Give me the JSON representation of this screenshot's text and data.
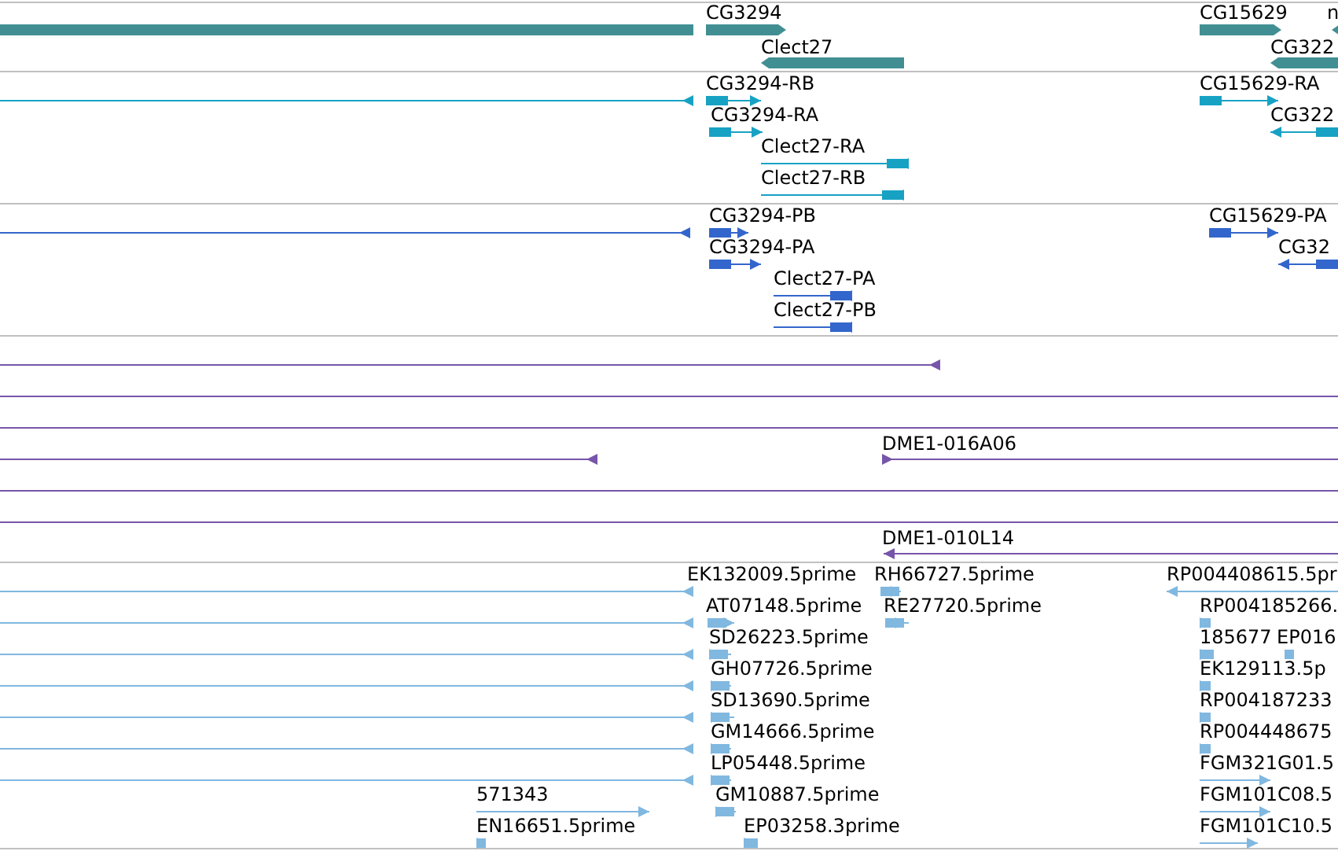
{
  "tracks": [
    {
      "kind": "gene",
      "color": "#418f93",
      "features": [
        {
          "kind": "span"
        },
        {
          "kind": "feature",
          "label": "CG3294",
          "reverse": false
        },
        {
          "kind": "feature",
          "label": "Clect27",
          "reverse": true
        },
        {
          "kind": "feature",
          "label": "CG15629",
          "reverse": false
        },
        {
          "kind": "feature",
          "label": "n",
          "reverse": true
        },
        {
          "kind": "feature",
          "label": "CG322",
          "reverse": true
        }
      ]
    },
    {
      "kind": "transcript",
      "color": "#17a2c4",
      "features": [
        {
          "kind": "feature",
          "reverse": true
        },
        {
          "kind": "feature",
          "label": "CG3294-RB",
          "reverse": false
        },
        {
          "kind": "feature",
          "label": "CG3294-RA",
          "reverse": false
        },
        {
          "kind": "feature",
          "label": "Clect27-RA",
          "reverse": true
        },
        {
          "kind": "feature",
          "label": "Clect27-RB",
          "reverse": true
        },
        {
          "kind": "feature",
          "label": "CG15629-RA",
          "reverse": false
        },
        {
          "kind": "feature",
          "label": "CG322",
          "reverse": true
        }
      ]
    },
    {
      "kind": "transcript",
      "color": "#3366cc",
      "features": [
        {
          "kind": "feature",
          "reverse": true
        },
        {
          "kind": "feature",
          "label": "CG3294-PB",
          "reverse": false
        },
        {
          "kind": "feature",
          "label": "CG3294-PA",
          "reverse": false
        },
        {
          "kind": "feature",
          "label": "Clect27-PA",
          "reverse": true
        },
        {
          "kind": "feature",
          "label": "Clect27-PB",
          "reverse": true
        },
        {
          "kind": "feature",
          "label": "CG15629-PA",
          "reverse": false
        },
        {
          "kind": "feature",
          "label": "CG32",
          "reverse": true
        }
      ]
    },
    {
      "kind": "clone",
      "color": "#7755aa",
      "features": [
        {
          "kind": "feature",
          "reverse": true
        },
        {
          "kind": "span"
        },
        {
          "kind": "span"
        },
        {
          "kind": "feature",
          "reverse": true
        },
        {
          "kind": "feature",
          "label": "DME1-016A06",
          "reverse": false
        },
        {
          "kind": "span"
        },
        {
          "kind": "span"
        },
        {
          "kind": "feature",
          "label": "DME1-010L14",
          "reverse": true
        }
      ]
    },
    {
      "kind": "est",
      "color": "#80b8e0",
      "features": [
        {
          "kind": "feature",
          "label": "EK132009.5prime",
          "reverse": true
        },
        {
          "kind": "feature",
          "label": "RH66727.5prime",
          "reverse": true
        },
        {
          "kind": "feature",
          "label": "RP004408615.5pr",
          "reverse": true
        },
        {
          "kind": "feature",
          "reverse": true
        },
        {
          "kind": "feature",
          "label": "AT07148.5prime",
          "reverse": false
        },
        {
          "kind": "feature",
          "label": "RE27720.5prime",
          "reverse": true
        },
        {
          "kind": "feature",
          "label": "RP004185266.",
          "reverse": false
        },
        {
          "kind": "feature",
          "reverse": true
        },
        {
          "kind": "feature",
          "label": "SD26223.5prime",
          "reverse": false
        },
        {
          "kind": "feature",
          "label": "185677",
          "reverse": false
        },
        {
          "kind": "feature",
          "label": "EP016",
          "reverse": true
        },
        {
          "kind": "feature",
          "reverse": true
        },
        {
          "kind": "feature",
          "label": "GH07726.5prime",
          "reverse": false
        },
        {
          "kind": "feature",
          "label": "EK129113.5p",
          "reverse": false
        },
        {
          "kind": "feature",
          "reverse": true
        },
        {
          "kind": "feature",
          "label": "SD13690.5prime",
          "reverse": false
        },
        {
          "kind": "feature",
          "label": "RP004187233",
          "reverse": false
        },
        {
          "kind": "feature",
          "reverse": true
        },
        {
          "kind": "feature",
          "label": "GM14666.5prime",
          "reverse": false
        },
        {
          "kind": "feature",
          "label": "RP004448675",
          "reverse": false
        },
        {
          "kind": "feature",
          "reverse": true
        },
        {
          "kind": "feature",
          "label": "LP05448.5prime",
          "reverse": false
        },
        {
          "kind": "feature",
          "label": "FGM321G01.5",
          "reverse": false
        },
        {
          "kind": "feature",
          "label": "571343",
          "reverse": false
        },
        {
          "kind": "feature",
          "label": "GM10887.5prime",
          "reverse": false
        },
        {
          "kind": "feature",
          "label": "FGM101C08.5",
          "reverse": false
        },
        {
          "kind": "feature",
          "label": "EN16651.5prime",
          "reverse": false
        },
        {
          "kind": "feature",
          "label": "EP03258.3prime",
          "reverse": false
        },
        {
          "kind": "feature",
          "label": "FGM101C10.5",
          "reverse": false
        }
      ]
    }
  ]
}
